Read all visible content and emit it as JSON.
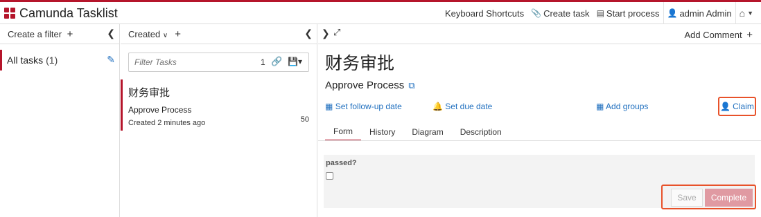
{
  "app": {
    "title": "Camunda Tasklist"
  },
  "topnav": {
    "keyboard_shortcuts": "Keyboard Shortcuts",
    "create_task": "Create task",
    "start_process": "Start process",
    "user": "admin Admin"
  },
  "filters": {
    "create_label": "Create a filter",
    "items": [
      {
        "label": "All tasks",
        "count": "(1)"
      }
    ]
  },
  "list": {
    "sort_label": "Created",
    "search_placeholder": "Filter Tasks",
    "result_count": "1",
    "tasks": [
      {
        "name": "财务审批",
        "process": "Approve Process",
        "created": "Created 2 minutes ago",
        "priority": "50"
      }
    ]
  },
  "detail": {
    "add_comment": "Add Comment",
    "task_title": "财务审批",
    "process_name": "Approve Process",
    "actions": {
      "follow_up": "Set follow-up date",
      "due_date": "Set due date",
      "add_groups": "Add groups",
      "claim": "Claim"
    },
    "tabs": [
      "Form",
      "History",
      "Diagram",
      "Description"
    ],
    "active_tab": "Form",
    "form": {
      "field_label": "passed?",
      "save_label": "Save",
      "complete_label": "Complete"
    }
  },
  "colors": {
    "brand": "#b5152b",
    "link": "#1f6fbf",
    "highlight": "#e8522a",
    "complete_disabled": "#e09aa2"
  },
  "icons": {
    "logo": "camunda-logo-icon",
    "keyboard": "keyboard-icon",
    "create_task": "paperclip-icon",
    "start_process": "list-icon",
    "user": "user-icon",
    "home": "home-icon",
    "edit": "pencil-icon",
    "link": "link-icon",
    "save_filter": "floppy-icon",
    "calendar": "calendar-icon",
    "bell": "bell-icon",
    "groups": "grid-icon",
    "external": "external-link-icon",
    "expand": "expand-icon"
  }
}
